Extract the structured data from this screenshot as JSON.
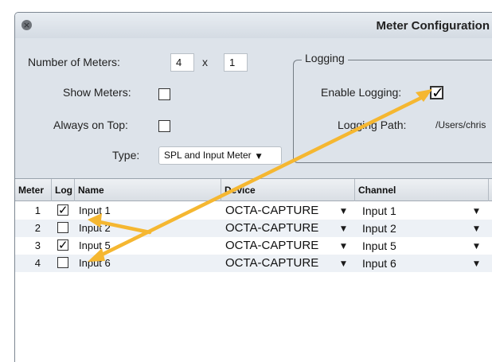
{
  "window": {
    "title": "Meter Configuration"
  },
  "settings": {
    "number_of_meters_label": "Number of Meters:",
    "meters_cols": "4",
    "times": "x",
    "meters_rows": "1",
    "show_meters_label": "Show Meters:",
    "show_meters_checked": false,
    "always_on_top_label": "Always on Top:",
    "always_on_top_checked": false,
    "type_label": "Type:",
    "type_value": "SPL and Input Meter"
  },
  "logging": {
    "group_label": "Logging",
    "enable_label": "Enable Logging:",
    "enable_checked": true,
    "path_label": "Logging Path:",
    "path_value": "/Users/chris"
  },
  "table": {
    "headers": {
      "meter": "Meter",
      "log": "Log",
      "name": "Name",
      "device": "Device",
      "channel": "Channel"
    },
    "rows": [
      {
        "meter": "1",
        "log": true,
        "name": "Input 1",
        "device": "OCTA-CAPTURE",
        "channel": "Input 1"
      },
      {
        "meter": "2",
        "log": false,
        "name": "Input 2",
        "device": "OCTA-CAPTURE",
        "channel": "Input 2"
      },
      {
        "meter": "3",
        "log": true,
        "name": "Input 5",
        "device": "OCTA-CAPTURE",
        "channel": "Input 5"
      },
      {
        "meter": "4",
        "log": false,
        "name": "Input 6",
        "device": "OCTA-CAPTURE",
        "channel": "Input 6"
      }
    ]
  },
  "icons": {
    "close": "close-icon",
    "checkmark": "checkmark-icon",
    "dropdown": "chevron-down-icon",
    "annotation": "arrow-annotation"
  },
  "colors": {
    "annotation_arrow": "#f5b731",
    "window_bg": "#dde3ea",
    "alt_row": "#edf1f6"
  }
}
